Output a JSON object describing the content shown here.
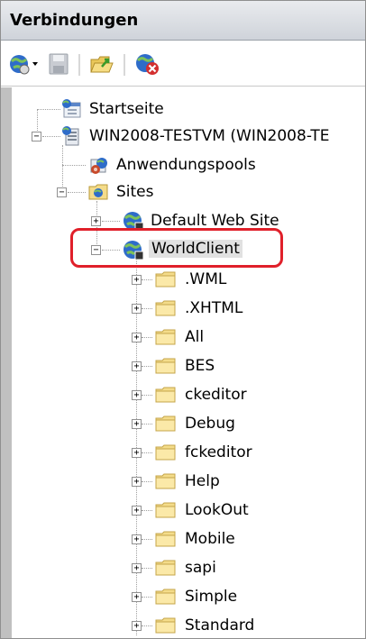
{
  "panel": {
    "title": "Verbindungen"
  },
  "toolbar": {
    "buttons": [
      {
        "icon": "connect-globe-icon",
        "has_dropdown": true
      },
      {
        "icon": "save-icon"
      },
      {
        "icon": "open-folder-icon"
      },
      {
        "icon": "disconnect-icon"
      }
    ]
  },
  "tree": {
    "startseite": "Startseite",
    "server": "WIN2008-TESTVM (WIN2008-TE",
    "apppools": "Anwendungspools",
    "sites": "Sites",
    "default_site": "Default Web Site",
    "worldclient": "WorldClient",
    "folders": [
      ".WML",
      ".XHTML",
      "All",
      "BES",
      "ckeditor",
      "Debug",
      "fckeditor",
      "Help",
      "LookOut",
      "Mobile",
      "sapi",
      "Simple",
      "Standard"
    ]
  },
  "colors": {
    "highlight_ring": "#e0202a",
    "header_bg": "#d6d9df",
    "folder_fill": "#f4dc8a"
  }
}
